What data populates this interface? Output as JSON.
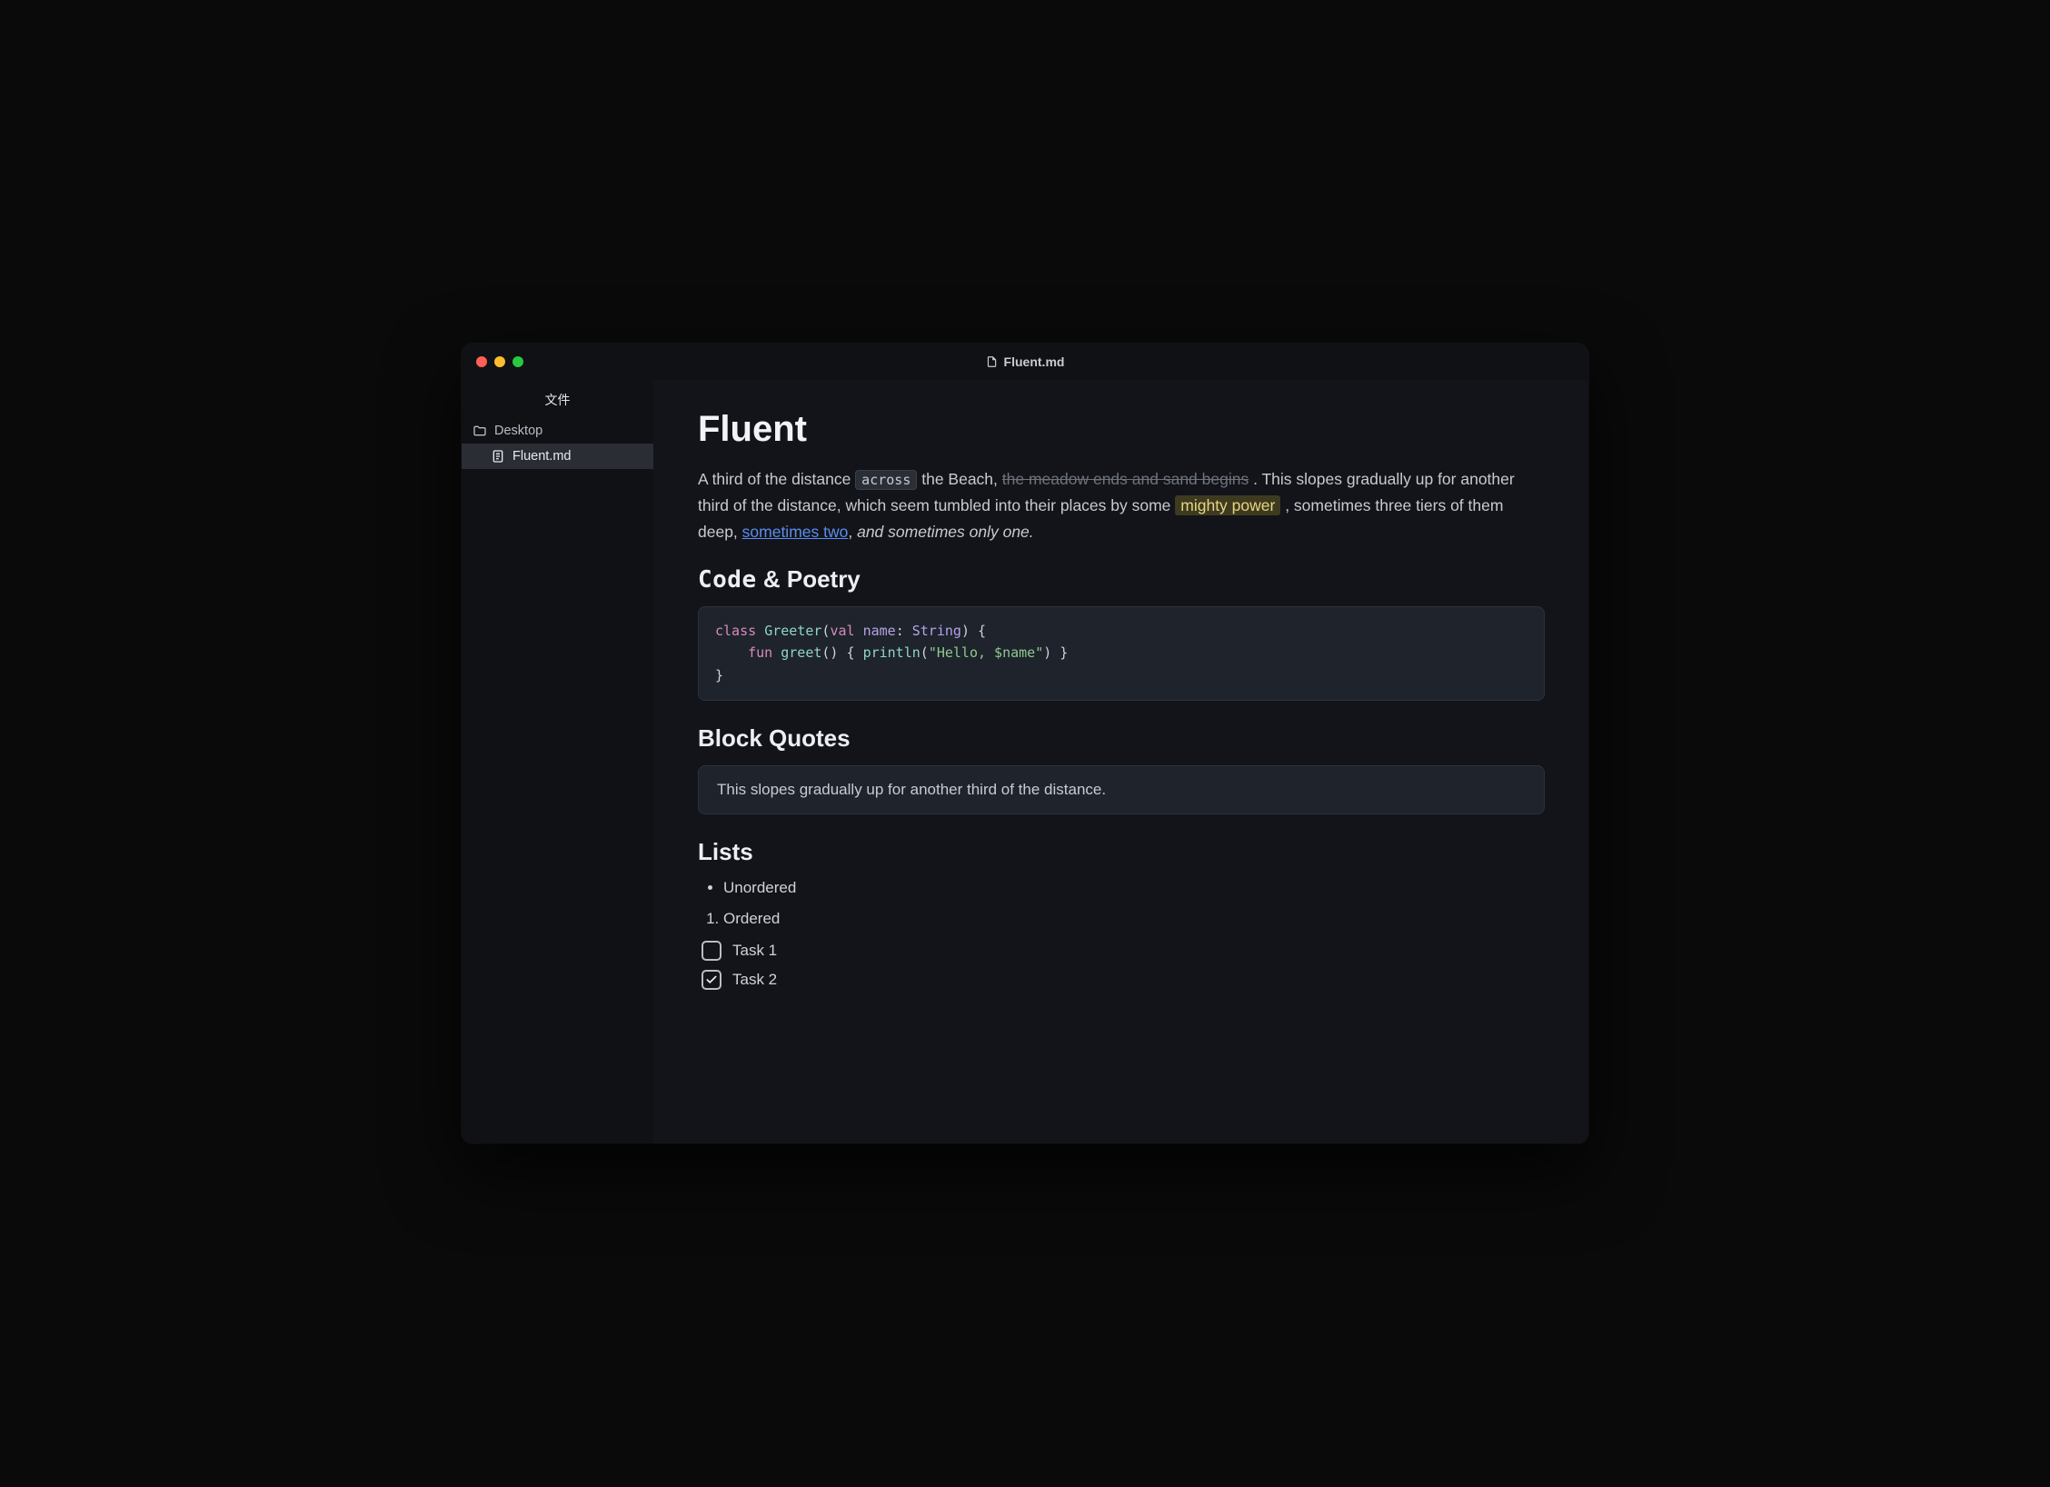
{
  "titlebar": {
    "filename": "Fluent.md"
  },
  "sidebar": {
    "header": "文件",
    "items": [
      {
        "icon": "folder",
        "label": "Desktop",
        "active": false
      },
      {
        "icon": "document",
        "label": "Fluent.md",
        "active": true
      }
    ]
  },
  "document": {
    "title": "Fluent",
    "paragraph": {
      "segments": [
        {
          "type": "text",
          "value": "A third of the distance "
        },
        {
          "type": "code",
          "value": "across"
        },
        {
          "type": "text",
          "value": " the Beach, "
        },
        {
          "type": "strike",
          "value": "the meadow ends and sand begins"
        },
        {
          "type": "text",
          "value": " . This slopes gradually up for another third of the distance, which seem tumbled into their places by some "
        },
        {
          "type": "highlight",
          "value": "mighty power"
        },
        {
          "type": "text",
          "value": " , sometimes three tiers of them deep, "
        },
        {
          "type": "link",
          "value": "sometimes two"
        },
        {
          "type": "text",
          "value": ", "
        },
        {
          "type": "italic",
          "value": "and sometimes only one."
        }
      ]
    },
    "sections": [
      {
        "heading_parts": [
          {
            "style": "mono",
            "value": "Code"
          },
          {
            "style": "normal",
            "value": " & Poetry"
          }
        ],
        "code": {
          "tokens": [
            [
              {
                "c": "kw",
                "t": "class"
              },
              {
                "c": "punc",
                "t": " "
              },
              {
                "c": "fn",
                "t": "Greeter"
              },
              {
                "c": "punc",
                "t": "("
              },
              {
                "c": "kw",
                "t": "val"
              },
              {
                "c": "punc",
                "t": " "
              },
              {
                "c": "type",
                "t": "name"
              },
              {
                "c": "punc",
                "t": ": "
              },
              {
                "c": "type",
                "t": "String"
              },
              {
                "c": "punc",
                "t": ") {"
              }
            ],
            [
              {
                "c": "punc",
                "t": "    "
              },
              {
                "c": "kw",
                "t": "fun"
              },
              {
                "c": "punc",
                "t": " "
              },
              {
                "c": "fn",
                "t": "greet"
              },
              {
                "c": "punc",
                "t": "() { "
              },
              {
                "c": "fn",
                "t": "println"
              },
              {
                "c": "punc",
                "t": "("
              },
              {
                "c": "str",
                "t": "\"Hello, $name\""
              },
              {
                "c": "punc",
                "t": ") }"
              }
            ],
            [
              {
                "c": "punc",
                "t": "}"
              }
            ]
          ]
        }
      },
      {
        "heading": "Block Quotes",
        "quote": "This slopes gradually up for another third of the distance."
      },
      {
        "heading": "Lists",
        "unordered": [
          "Unordered"
        ],
        "ordered": [
          "Ordered"
        ],
        "tasks": [
          {
            "checked": false,
            "label": "Task 1"
          },
          {
            "checked": true,
            "label": "Task 2"
          }
        ]
      }
    ]
  }
}
